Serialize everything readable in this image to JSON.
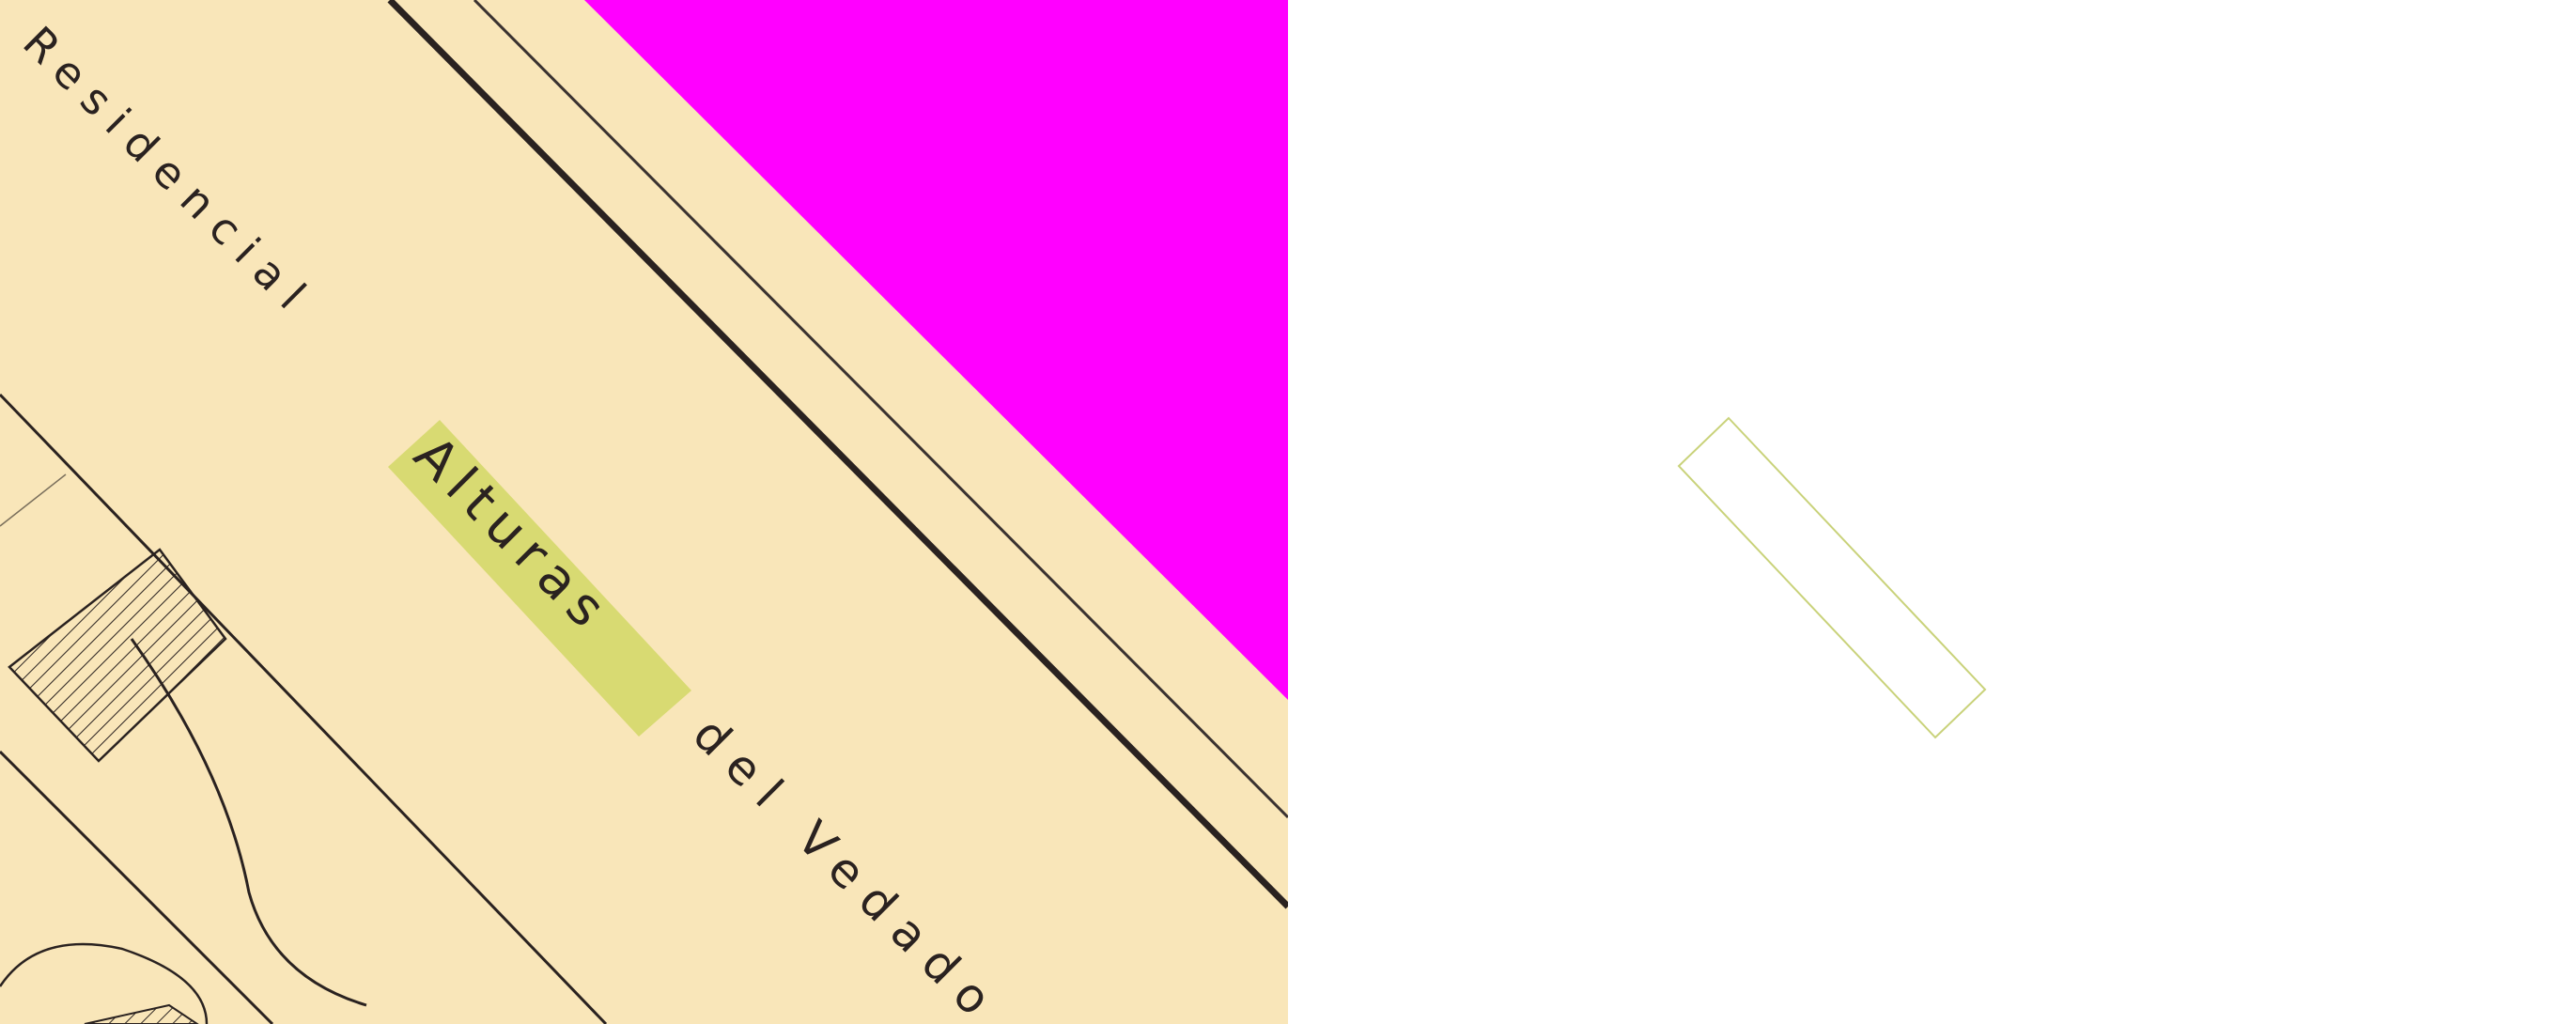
{
  "map": {
    "label_line_1": "Residencial",
    "label_line_2_highlighted": "Alturas",
    "label_line_2_rest": "del Vedado",
    "colors": {
      "paper": "#f9e6b9",
      "ink": "#2a2220",
      "highlight": "#d4d86a",
      "background_mask": "#ff00ff",
      "outline": "#c9d27a"
    }
  },
  "outline_panel": {
    "shape": "rotated-rectangle"
  }
}
